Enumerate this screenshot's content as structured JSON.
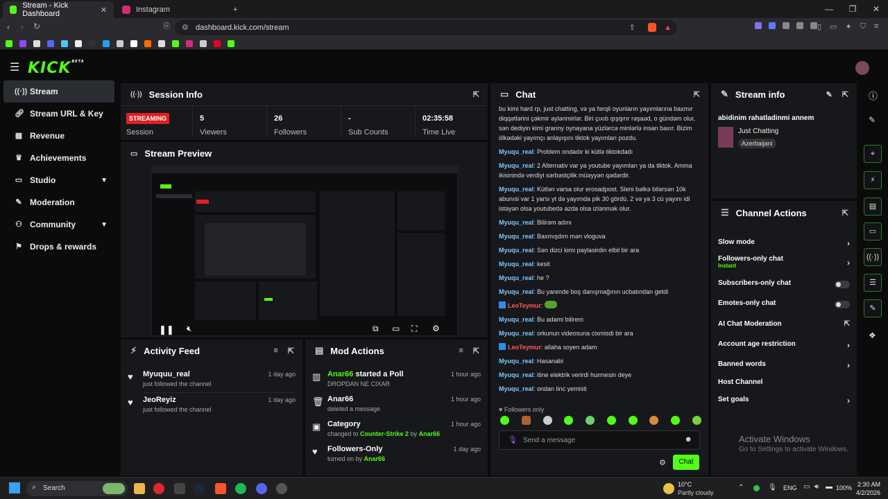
{
  "browser": {
    "tabs": [
      {
        "label": "Stream - Kick Dashboard",
        "active": true
      },
      {
        "label": "Instagram",
        "active": false
      }
    ],
    "url": "dashboard.kick.com/stream"
  },
  "brand": {
    "logo": "KICK",
    "beta": "BETA",
    "accent": "#53fc18"
  },
  "sidebar": {
    "items": [
      {
        "label": "Stream",
        "icon": "broadcast-icon"
      },
      {
        "label": "Stream URL & Key",
        "icon": "link-icon"
      },
      {
        "label": "Revenue",
        "icon": "revenue-icon"
      },
      {
        "label": "Achievements",
        "icon": "trophy-icon"
      },
      {
        "label": "Studio",
        "icon": "studio-icon"
      },
      {
        "label": "Moderation",
        "icon": "wrench-icon"
      },
      {
        "label": "Community",
        "icon": "community-icon"
      },
      {
        "label": "Drops & rewards",
        "icon": "gift-icon"
      }
    ]
  },
  "session": {
    "title": "Session Info",
    "status": "STREAMING",
    "status_label": "Session",
    "viewers": "5",
    "viewers_label": "Viewers",
    "followers": "26",
    "followers_label": "Followers",
    "subs": "-",
    "subs_label": "Sub Counts",
    "time": "02:35:58",
    "time_label": "Time Live"
  },
  "preview": {
    "title": "Stream Preview"
  },
  "activity": {
    "title": "Activity Feed",
    "items": [
      {
        "user": "Myuquu_real",
        "text": "just followed the channel",
        "time": "1 day ago"
      },
      {
        "user": "JeoReyiz",
        "text": "just followed the channel",
        "time": "1 day ago"
      }
    ]
  },
  "modactions": {
    "title": "Mod Actions",
    "items": [
      {
        "title_green": "Anar66",
        "title_rest": " started a Poll",
        "sub": "DROPDAN NE CIXAR",
        "time": "1 hour ago"
      },
      {
        "title_green": "",
        "title_rest": "Anar66",
        "sub": "deleted a message",
        "time": "1 hour ago"
      },
      {
        "title_green": "",
        "title_rest": "Category",
        "sub_pre": "changed to ",
        "sub_green": "Counter-Strike 2",
        "sub_mid": " by ",
        "sub_green2": "Anar66",
        "time": "1 hour ago"
      },
      {
        "title_green": "",
        "title_rest": "Followers-Only",
        "sub_pre": "turned on by ",
        "sub_green": "Anar66",
        "time": "1 day ago"
      }
    ]
  },
  "chat": {
    "title": "Chat",
    "top_text": "bu kimi hard rp, just chatting, və ya fərqli oyunların yayımlarına baxmır diqqətlərini çəkmir əylənmirlər. Biri çıxıb qışqırır rəşaəd, o gündəm olur, sən dediyin kimi granny oynayana yüzlərcə minlərlə insan baxır. Bizim ölkədəki yayımçı anlayışını tiktok yayımları pozdu.",
    "messages": [
      {
        "user": "Myuqu_real",
        "text": "Problem ondadır ki kütlə tiktokdadı"
      },
      {
        "user": "Myuqu_real",
        "text": "2 Alternativ var ya youtube yayımları ya da tiktok. Amma ikisinində verdiyi sərbəstçilik müəyyən qədərdir."
      },
      {
        "user": "Myuqu_real",
        "text": "Kütlən varsa olur erosadpost. Sleni bəlkə bilərsən 10k abunısi var 1 yarsı yt də yayımda pik 30 gördü. 2 və ya 3 cü yayını idi istəyən olsa youtubedə azda olsa izlənmək olur."
      },
      {
        "user": "Myuqu_real",
        "text": "Bilirəm adını"
      },
      {
        "user": "Myuqu_real",
        "text": "Baxmışdım mən vloguva"
      },
      {
        "user": "Myuqu_real",
        "text": "Sən dizci kimi paylasirdin elbil bir ara"
      },
      {
        "user": "Myuqu_real",
        "text": "kesit"
      },
      {
        "user": "Myuqu_real",
        "text": "he ?"
      },
      {
        "user": "Myuqu_real",
        "text": "Bu yarende boş danışmağının ucbatından getdi"
      },
      {
        "user": "LeoTeymur",
        "text": "",
        "red": true,
        "emote": true
      },
      {
        "user": "Myuqu_real",
        "text": "Bu adami bilirem"
      },
      {
        "user": "Myuqu_real",
        "text": "orkunun videosuna cixmisdi bir ara"
      },
      {
        "user": "LeoTeymur",
        "text": "allaha soyen adam",
        "red": true
      },
      {
        "user": "Myuqu_real",
        "text": "Hasanabi"
      },
      {
        "user": "Myuqu_real",
        "text": "itine elektrik verirdi hurmesin deye"
      },
      {
        "user": "Myuqu_real",
        "text": "ondan linc yemisti"
      }
    ],
    "followers_only": "Followers only",
    "placeholder": "Send a message",
    "send_label": "Chat"
  },
  "streaminfo": {
    "title": "Stream info",
    "stream_title": "abidinim rahatladinmi annem",
    "category": "Just Chatting",
    "tag": "Azerbaijani"
  },
  "channel_actions": {
    "title": "Channel Actions",
    "items": [
      {
        "label": "Slow mode",
        "control": "chevron"
      },
      {
        "label": "Followers-only chat",
        "sub": "Instant",
        "control": "chevron"
      },
      {
        "label": "Subscribers-only chat",
        "control": "toggle"
      },
      {
        "label": "Emotes-only chat",
        "control": "toggle"
      },
      {
        "label": "AI Chat Moderation",
        "control": "external"
      },
      {
        "label": "Account age restriction",
        "control": "chevron"
      },
      {
        "label": "Banned words",
        "control": "chevron"
      },
      {
        "label": "Host Channel",
        "control": "none"
      },
      {
        "label": "Set goals",
        "control": "chevron"
      }
    ]
  },
  "watermark": {
    "line1": "Activate Windows",
    "line2": "Go to Settings to activate Windows."
  },
  "taskbar": {
    "search": "Search",
    "weather_temp": "10°C",
    "weather_desc": "Partly cloudy",
    "lang": "ENG",
    "battery": "100%",
    "time": "2:30 AM",
    "date": "4/2/2026"
  }
}
